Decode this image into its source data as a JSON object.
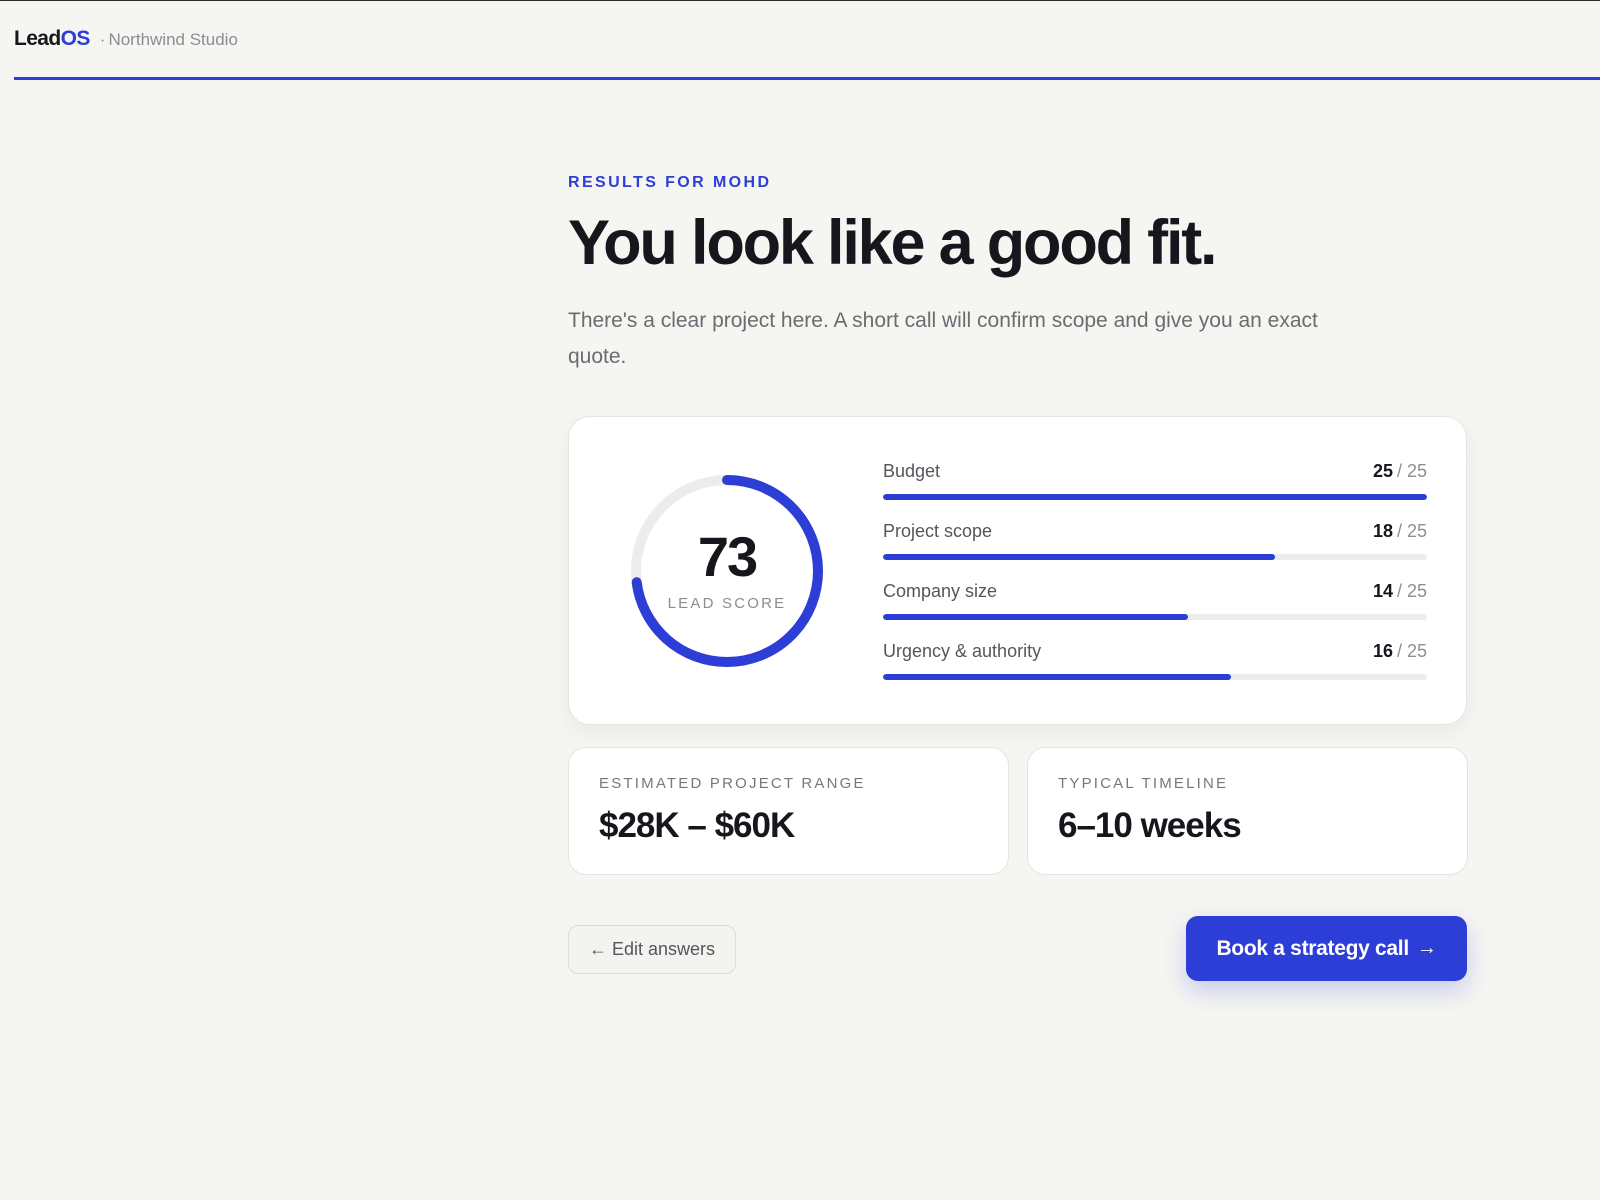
{
  "header": {
    "logo_part1": "Lead",
    "logo_part2": "OS",
    "separator": "·",
    "organization": "Northwind Studio",
    "accent_color": "#2d3ed6"
  },
  "results": {
    "eyebrow": "RESULTS FOR MOHD",
    "headline": "You look like a good fit.",
    "description": "There's a clear project here. A short call will confirm scope and give you an exact quote."
  },
  "score": {
    "value": 73,
    "max": 100,
    "label": "LEAD SCORE"
  },
  "metrics": [
    {
      "name": "Budget",
      "score": 25,
      "max_text": "/ 25",
      "max": 25
    },
    {
      "name": "Project scope",
      "score": 18,
      "max_text": "/ 25",
      "max": 25
    },
    {
      "name": "Company size",
      "score": 14,
      "max_text": "/ 25",
      "max": 25
    },
    {
      "name": "Urgency & authority",
      "score": 16,
      "max_text": "/ 25",
      "max": 25
    }
  ],
  "stats": {
    "range_label": "ESTIMATED PROJECT RANGE",
    "range_value": "$28K – $60K",
    "timeline_label": "TYPICAL TIMELINE",
    "timeline_value": "6–10 weeks"
  },
  "actions": {
    "edit_arrow": "←",
    "edit_label": "Edit answers",
    "book_label": "Book a strategy call",
    "book_arrow": "→"
  }
}
